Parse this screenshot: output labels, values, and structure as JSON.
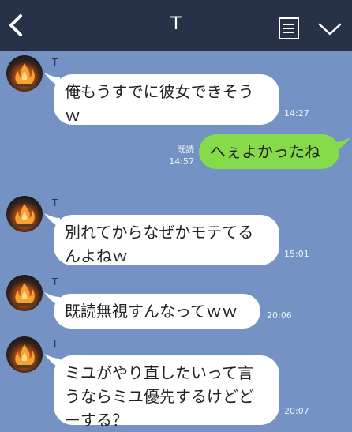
{
  "header": {
    "title": "T"
  },
  "messages": [
    {
      "sender": "T",
      "text_lines": [
        "俺もうすでに彼女できそう",
        "ｗ"
      ],
      "time": "14:27"
    },
    {
      "text": "へぇよかったね",
      "read": "既読",
      "time": "14:57"
    },
    {
      "sender": "T",
      "text_lines": [
        "別れてからなぜかモテてる",
        "んよねｗ"
      ],
      "time": "15:01"
    },
    {
      "sender": "T",
      "text": "既読無視すんなってｗｗ",
      "time": "20:06"
    },
    {
      "sender": "T",
      "text_lines": [
        "ミユがやり直したいって言",
        "うならミユ優先するけどど",
        "ーする？"
      ],
      "time": "20:07"
    }
  ]
}
